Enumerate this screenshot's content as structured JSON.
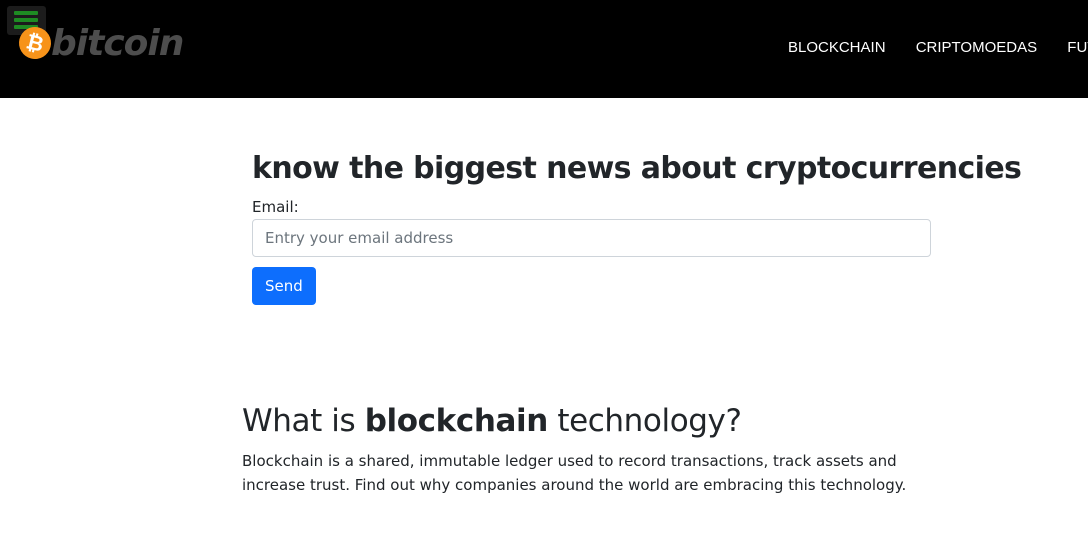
{
  "header": {
    "brand_symbol": "₿",
    "brand_name": "bitcoin",
    "nav": [
      "BLOCKCHAIN",
      "CRIPTOMOEDAS",
      "FUTURO"
    ]
  },
  "newsletter": {
    "title": "know the biggest news about cryptocurrencies",
    "email_label": "Email:",
    "email_placeholder": "Entry your email address",
    "email_value": "",
    "send_label": "Send"
  },
  "blockchain_section": {
    "title_before": "What is ",
    "title_bold": "blockchain",
    "title_after": " technology?",
    "description": "Blockchain is a shared, immutable ledger used to record transactions, track assets and increase trust. Find out why companies around the world are embracing this technology."
  },
  "colors": {
    "navbar_bg": "#000000",
    "hamburger_green": "#1e8c23",
    "bitcoin_orange": "#f7931a",
    "button_blue": "#0d6efd"
  },
  "icons": [
    "hamburger-menu-icon",
    "bitcoin-logo-icon"
  ]
}
